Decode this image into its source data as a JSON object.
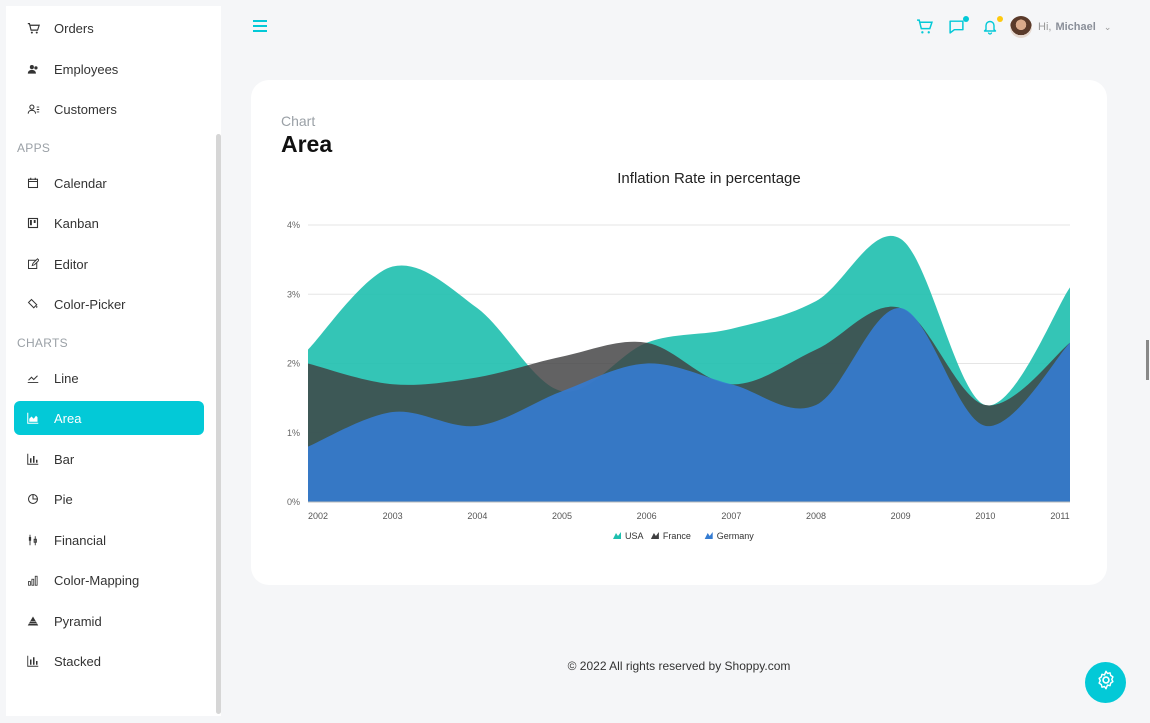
{
  "sidebar": {
    "items_top": [
      {
        "label": "Orders",
        "icon": "cart-icon"
      },
      {
        "label": "Employees",
        "icon": "employees-icon"
      },
      {
        "label": "Customers",
        "icon": "customers-icon"
      }
    ],
    "apps_title": "APPS",
    "apps": [
      {
        "label": "Calendar",
        "icon": "calendar-icon"
      },
      {
        "label": "Kanban",
        "icon": "kanban-icon"
      },
      {
        "label": "Editor",
        "icon": "editor-icon"
      },
      {
        "label": "Color-Picker",
        "icon": "color-picker-icon"
      }
    ],
    "charts_title": "CHARTS",
    "charts": [
      {
        "label": "Line",
        "icon": "line-chart-icon"
      },
      {
        "label": "Area",
        "icon": "area-chart-icon",
        "active": true
      },
      {
        "label": "Bar",
        "icon": "bar-chart-icon"
      },
      {
        "label": "Pie",
        "icon": "pie-chart-icon"
      },
      {
        "label": "Financial",
        "icon": "financial-icon"
      },
      {
        "label": "Color-Mapping",
        "icon": "color-mapping-icon"
      },
      {
        "label": "Pyramid",
        "icon": "pyramid-icon"
      },
      {
        "label": "Stacked",
        "icon": "stacked-icon"
      }
    ]
  },
  "header": {
    "greeting": "Hi,",
    "user_name": "Michael",
    "accent": "#03c9d7",
    "chat_dot_color": "#03c9d7",
    "notification_dot_color": "#fec90f"
  },
  "page": {
    "category": "Chart",
    "title": "Area"
  },
  "chart_data": {
    "type": "area",
    "title": "Inflation Rate in percentage",
    "xlabel": "",
    "ylabel": "",
    "x": [
      "2002",
      "2003",
      "2004",
      "2005",
      "2006",
      "2007",
      "2008",
      "2009",
      "2010",
      "2011"
    ],
    "ylim": [
      0,
      4
    ],
    "yticks": [
      "0%",
      "1%",
      "2%",
      "3%",
      "4%"
    ],
    "legend_position": "bottom",
    "grid": true,
    "series": [
      {
        "name": "USA",
        "color": "#1ebfae",
        "values": [
          2.2,
          3.4,
          2.8,
          1.6,
          2.3,
          2.5,
          2.9,
          3.8,
          1.4,
          3.1
        ]
      },
      {
        "name": "France",
        "color": "#404041",
        "values": [
          2.0,
          1.7,
          1.8,
          2.1,
          2.3,
          1.7,
          2.2,
          2.8,
          1.4,
          2.3
        ]
      },
      {
        "name": "Germany",
        "color": "#357cd2",
        "values": [
          0.8,
          1.3,
          1.1,
          1.6,
          2.0,
          1.7,
          1.4,
          2.8,
          1.1,
          2.3
        ]
      }
    ]
  },
  "footer": {
    "text": "© 2022 All rights reserved by Shoppy.com"
  }
}
